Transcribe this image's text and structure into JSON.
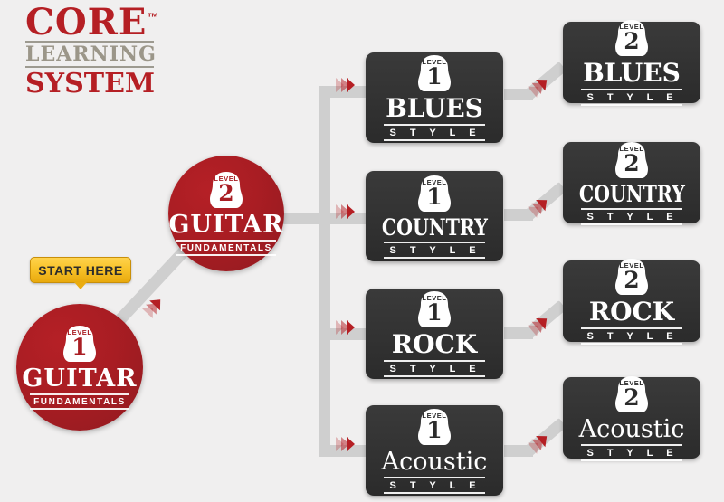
{
  "logo": {
    "line1": "CORE",
    "tm": "™",
    "line2": "LEARNING",
    "line3": "SYSTEM",
    "color_primary": "#b51f24",
    "color_secondary": "#9b9689"
  },
  "cta": {
    "label": "START HERE",
    "color": "#f5c32a"
  },
  "labels": {
    "level_word": "LEVEL",
    "fundamentals": "FUNDAMENTALS",
    "style": "S T Y L E"
  },
  "colors": {
    "background": "#f0efef",
    "red": "#a91d23",
    "box_dark": "#333333",
    "pipe": "#cfcfcf",
    "arrow": "#b51f24"
  },
  "nodes": {
    "guitar_l1": {
      "level": "1",
      "level_word": "LEVEL",
      "title": "GUITAR",
      "subtitle": "FUNDAMENTALS",
      "shape": "circle",
      "color": "#a91d23"
    },
    "guitar_l2": {
      "level": "2",
      "level_word": "LEVEL",
      "title": "GUITAR",
      "subtitle": "FUNDAMENTALS",
      "shape": "circle",
      "color": "#a91d23"
    },
    "blues_l1": {
      "level": "1",
      "level_word": "LEVEL",
      "title": "BLUES",
      "subtitle": "S T Y L E",
      "shape": "box",
      "color": "#333333"
    },
    "country_l1": {
      "level": "1",
      "level_word": "LEVEL",
      "title": "COUNTRY",
      "subtitle": "S T Y L E",
      "shape": "box",
      "color": "#333333"
    },
    "rock_l1": {
      "level": "1",
      "level_word": "LEVEL",
      "title": "ROCK",
      "subtitle": "S T Y L E",
      "shape": "box",
      "color": "#333333"
    },
    "acoustic_l1": {
      "level": "1",
      "level_word": "LEVEL",
      "title": "Acoustic",
      "subtitle": "S T Y L E",
      "shape": "box",
      "color": "#333333"
    },
    "blues_l2": {
      "level": "2",
      "level_word": "LEVEL",
      "title": "BLUES",
      "subtitle": "S T Y L E",
      "shape": "box",
      "color": "#333333"
    },
    "country_l2": {
      "level": "2",
      "level_word": "LEVEL",
      "title": "COUNTRY",
      "subtitle": "S T Y L E",
      "shape": "box",
      "color": "#333333"
    },
    "rock_l2": {
      "level": "2",
      "level_word": "LEVEL",
      "title": "ROCK",
      "subtitle": "S T Y L E",
      "shape": "box",
      "color": "#333333"
    },
    "acoustic_l2": {
      "level": "2",
      "level_word": "LEVEL",
      "title": "Acoustic",
      "subtitle": "S T Y L E",
      "shape": "box",
      "color": "#333333"
    }
  }
}
